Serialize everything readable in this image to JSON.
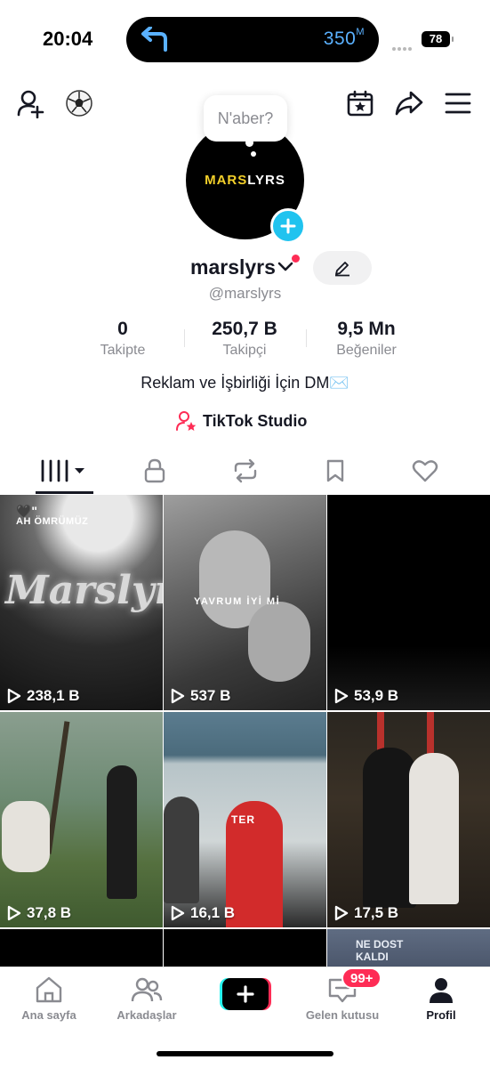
{
  "status_bar": {
    "time": "20:04",
    "distance": "350",
    "distance_unit": "M",
    "battery": "78"
  },
  "profile": {
    "avatar_brand_part1": "MARS",
    "avatar_brand_part2": "LYRS",
    "note_bubble": "N'aber?",
    "name": "marslyrs",
    "handle": "@marslyrs",
    "stats": [
      {
        "value": "0",
        "label": "Takipte"
      },
      {
        "value": "250,7 B",
        "label": "Takipçi"
      },
      {
        "value": "9,5 Mn",
        "label": "Beğeniler"
      }
    ],
    "bio": "Reklam ve İşbirliği İçin DM✉️",
    "studio_label": "TikTok Studio"
  },
  "videos": [
    {
      "views": "238,1 B",
      "overlay_top": "AH ÖMRÜMÜZ",
      "overlay_main": "Marslyrs"
    },
    {
      "views": "537 B",
      "overlay_main": "YAVRUM İYİ Mİ"
    },
    {
      "views": "53,9 B"
    },
    {
      "views": "37,8 B"
    },
    {
      "views": "16,1 B",
      "overlay_main": "TER"
    },
    {
      "views": "17,5 B"
    },
    {
      "overlay_main": "NE DOST\nKALDI"
    }
  ],
  "bottom_nav": {
    "home": "Ana sayfa",
    "friends": "Arkadaşlar",
    "inbox": "Gelen kutusu",
    "inbox_badge": "99+",
    "profile": "Profil"
  },
  "colors": {
    "accent_red": "#fe2c55",
    "accent_cyan": "#20c3ef",
    "brand_yellow": "#f3d02a",
    "text_primary": "#161823",
    "text_secondary": "#8a8b91"
  }
}
